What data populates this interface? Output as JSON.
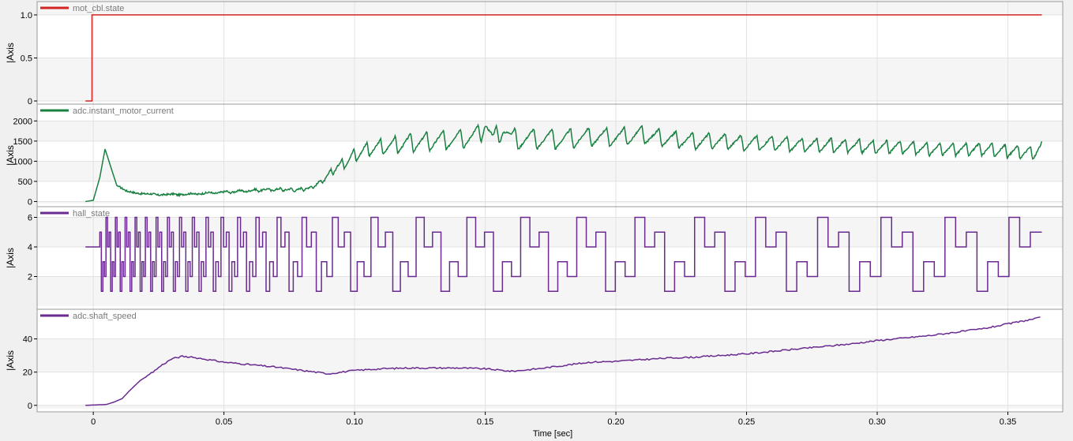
{
  "x_axis": {
    "label": "Time [sec]",
    "range": [
      -0.0215,
      0.371
    ],
    "ticks": [
      0,
      0.05,
      0.1,
      0.15,
      0.2,
      0.25,
      0.3,
      0.35
    ],
    "tick_labels": [
      "0",
      "0.05",
      "0.10",
      "0.15",
      "0.20",
      "0.25",
      "0.30",
      "0.35"
    ]
  },
  "colors": {
    "background": "#f0f0f0",
    "plot_bg": "#ffffff",
    "band": "#f5f5f5",
    "grid": "#e2e2e2",
    "axis_text": "#000000",
    "legend_text": "#7a7a7a"
  },
  "chart_data": [
    {
      "type": "line",
      "series": [
        {
          "name": "mot_cbl.state",
          "color": "#d32424"
        }
      ],
      "ylabel": "|Axis",
      "ylim": [
        0,
        1.1
      ],
      "yticks": [
        0,
        0.5,
        1.0
      ],
      "ytick_labels": [
        "0",
        "0.5",
        "1.0"
      ],
      "grid": true,
      "legend": "top-left",
      "points": [
        [
          -0.003,
          0
        ],
        [
          -0.0005,
          0
        ],
        [
          -0.0005,
          1
        ],
        [
          0.363,
          1
        ]
      ]
    },
    {
      "type": "line",
      "series": [
        {
          "name": "adc.instant_motor_current",
          "color": "#188040"
        }
      ],
      "ylabel": "|Axis",
      "ylim": [
        -50,
        2300
      ],
      "yticks": [
        0,
        500,
        1000,
        1500,
        2000
      ],
      "ytick_labels": [
        "0",
        "500",
        "1000",
        "1500",
        "2000"
      ],
      "grid": true,
      "legend": "top-left",
      "base_points": [
        [
          -0.003,
          0
        ],
        [
          0,
          30
        ],
        [
          0.0025,
          600
        ],
        [
          0.0045,
          1300
        ],
        [
          0.0065,
          900
        ],
        [
          0.009,
          400
        ],
        [
          0.013,
          250
        ],
        [
          0.018,
          200
        ],
        [
          0.025,
          170
        ],
        [
          0.035,
          180
        ],
        [
          0.045,
          210
        ],
        [
          0.055,
          250
        ],
        [
          0.065,
          290
        ],
        [
          0.072,
          300
        ],
        [
          0.078,
          290
        ],
        [
          0.083,
          340
        ],
        [
          0.087,
          480
        ],
        [
          0.09,
          650
        ],
        [
          0.093,
          850
        ],
        [
          0.097,
          1000
        ],
        [
          0.1,
          1150
        ],
        [
          0.105,
          1300
        ],
        [
          0.11,
          1350
        ],
        [
          0.12,
          1450
        ],
        [
          0.13,
          1500
        ],
        [
          0.14,
          1550
        ],
        [
          0.148,
          1650
        ],
        [
          0.15,
          2000
        ],
        [
          0.153,
          1500
        ],
        [
          0.157,
          1850
        ],
        [
          0.16,
          1550
        ],
        [
          0.17,
          1550
        ],
        [
          0.18,
          1550
        ],
        [
          0.19,
          1600
        ],
        [
          0.2,
          1600
        ],
        [
          0.21,
          1650
        ],
        [
          0.22,
          1550
        ],
        [
          0.23,
          1500
        ],
        [
          0.24,
          1500
        ],
        [
          0.25,
          1450
        ],
        [
          0.26,
          1450
        ],
        [
          0.27,
          1400
        ],
        [
          0.28,
          1400
        ],
        [
          0.29,
          1380
        ],
        [
          0.3,
          1350
        ],
        [
          0.31,
          1350
        ],
        [
          0.32,
          1300
        ],
        [
          0.33,
          1300
        ],
        [
          0.34,
          1300
        ],
        [
          0.35,
          1250
        ],
        [
          0.36,
          1200
        ],
        [
          0.363,
          1350
        ]
      ],
      "ripple": [
        [
          0.0,
          0,
          0.01
        ],
        [
          0.083,
          40,
          0.0035
        ],
        [
          0.093,
          110,
          0.0042
        ],
        [
          0.1,
          170,
          0.0048
        ],
        [
          0.12,
          230,
          0.006
        ],
        [
          0.145,
          260,
          0.0068
        ],
        [
          0.16,
          270,
          0.0072
        ],
        [
          0.2,
          230,
          0.0068
        ],
        [
          0.25,
          190,
          0.006
        ],
        [
          0.3,
          170,
          0.0052
        ],
        [
          0.363,
          160,
          0.0048
        ]
      ]
    },
    {
      "type": "line",
      "series": [
        {
          "name": "hall_state",
          "color": "#6a2a90"
        }
      ],
      "ylabel": "|Axis",
      "ylim": [
        0,
        6.4
      ],
      "yticks": [
        2,
        4,
        6
      ],
      "ytick_labels": [
        "2",
        "4",
        "6"
      ],
      "grid": true,
      "legend": "top-left",
      "step_sequence": [
        5,
        1,
        3,
        2,
        6,
        4
      ],
      "initial_value": 4,
      "first_transition": 0.0025,
      "last_transition": 0.3625,
      "end_x": 0.363,
      "cycle_periods": [
        [
          0.0025,
          0.0035
        ],
        [
          0.02,
          0.004
        ],
        [
          0.04,
          0.0052
        ],
        [
          0.06,
          0.0072
        ],
        [
          0.08,
          0.0105
        ],
        [
          0.1,
          0.0155
        ],
        [
          0.13,
          0.0195
        ],
        [
          0.16,
          0.021
        ],
        [
          0.2,
          0.0225
        ],
        [
          0.25,
          0.0235
        ],
        [
          0.3,
          0.0245
        ],
        [
          0.363,
          0.0245
        ]
      ]
    },
    {
      "type": "line",
      "series": [
        {
          "name": "adc.shaft_speed",
          "color": "#6a2a90"
        }
      ],
      "ylabel": "|Axis",
      "ylim": [
        -2,
        55
      ],
      "yticks": [
        0,
        20,
        40
      ],
      "ytick_labels": [
        "0",
        "20",
        "40"
      ],
      "grid": true,
      "legend": "top-left",
      "points": [
        [
          -0.003,
          0
        ],
        [
          0.005,
          0.5
        ],
        [
          0.008,
          2
        ],
        [
          0.011,
          4
        ],
        [
          0.014,
          9
        ],
        [
          0.018,
          15
        ],
        [
          0.022,
          19
        ],
        [
          0.026,
          24
        ],
        [
          0.03,
          28
        ],
        [
          0.034,
          29.5
        ],
        [
          0.04,
          28.5
        ],
        [
          0.05,
          26
        ],
        [
          0.06,
          24.5
        ],
        [
          0.07,
          23
        ],
        [
          0.08,
          21
        ],
        [
          0.09,
          19
        ],
        [
          0.1,
          21
        ],
        [
          0.11,
          22
        ],
        [
          0.12,
          22.5
        ],
        [
          0.13,
          22.5
        ],
        [
          0.14,
          22.5
        ],
        [
          0.15,
          22
        ],
        [
          0.16,
          20.5
        ],
        [
          0.17,
          22
        ],
        [
          0.18,
          24
        ],
        [
          0.19,
          26
        ],
        [
          0.2,
          26.5
        ],
        [
          0.21,
          27.5
        ],
        [
          0.22,
          28.5
        ],
        [
          0.23,
          29
        ],
        [
          0.24,
          30
        ],
        [
          0.25,
          31
        ],
        [
          0.26,
          32.5
        ],
        [
          0.27,
          34
        ],
        [
          0.28,
          35.5
        ],
        [
          0.29,
          37
        ],
        [
          0.3,
          39
        ],
        [
          0.31,
          40.5
        ],
        [
          0.32,
          42
        ],
        [
          0.33,
          44
        ],
        [
          0.34,
          46
        ],
        [
          0.35,
          49
        ],
        [
          0.36,
          52
        ],
        [
          0.363,
          53
        ]
      ]
    }
  ]
}
